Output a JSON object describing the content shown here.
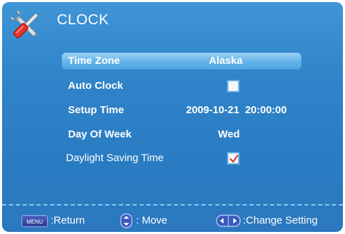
{
  "header": {
    "title": "CLOCK",
    "icon": "tools-icon"
  },
  "settings": {
    "time_zone": {
      "label": "Time Zone",
      "value": "Alaska"
    },
    "auto_clock": {
      "label": "Auto Clock",
      "checked": false
    },
    "setup_time": {
      "label": "Setup Time",
      "value": "2009-10-21  20:00:00"
    },
    "day_of_week": {
      "label": "Day Of Week",
      "value": "Wed"
    },
    "daylight_saving": {
      "label": "Daylight Saving Time",
      "checked": true
    }
  },
  "footer": {
    "menu_key": "MENU",
    "return_label": ":Return",
    "move_label": ": Move",
    "change_label": ":Change Setting"
  },
  "colors": {
    "background": "#2f83c8",
    "highlight": "#67b5ea",
    "text": "#ffffff"
  }
}
